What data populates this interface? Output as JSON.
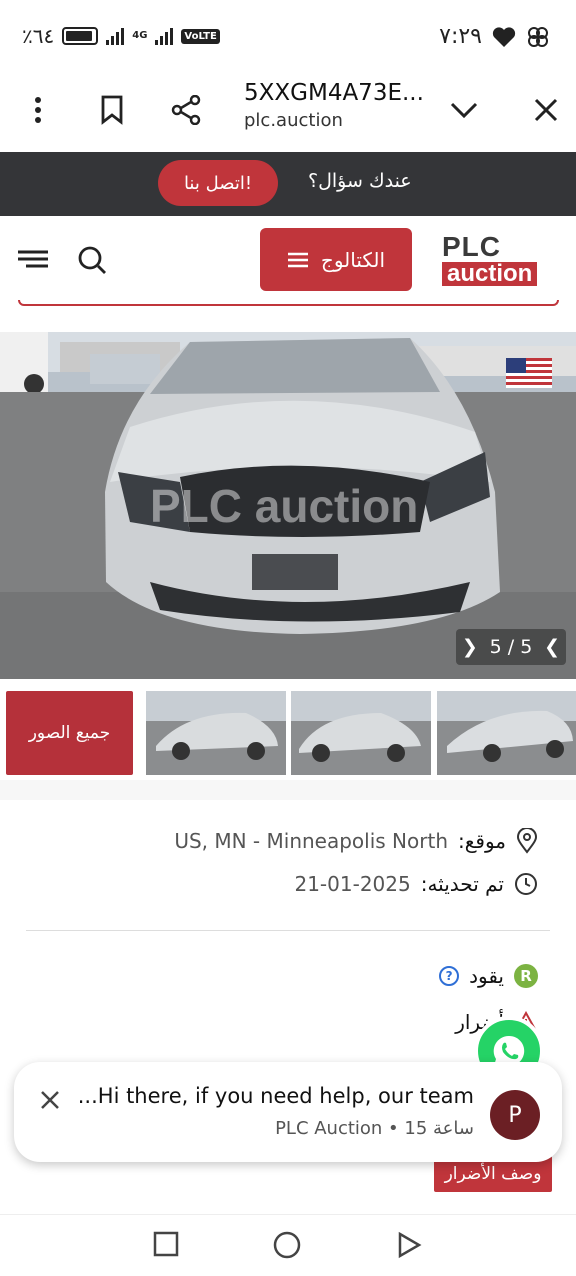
{
  "status_bar": {
    "battery_text": "٪٦٤",
    "network": "4G",
    "sim_slots": "1\n2",
    "volte": "VoLTE",
    "time": "٧:٢٩"
  },
  "browser": {
    "page_title": "5XXGM4A73E...",
    "host": "plc.auction",
    "icons": [
      "menu-dots-icon",
      "bookmark-icon",
      "share-icon",
      "chevron-down-icon",
      "close-icon"
    ]
  },
  "banner": {
    "question": "عندك سؤال؟",
    "contact_label": "اتصل بنا!"
  },
  "header": {
    "catalog_label": "الكتالوج",
    "logo_top": "PLC",
    "logo_bottom": "auction"
  },
  "gallery": {
    "pager": "5 / 5",
    "watermark": "PLC auction",
    "all_photos_label": "جميع الصور",
    "thumb_count": 3
  },
  "info": {
    "location_label": "موقع:",
    "location_value": "US, MN - Minneapolis North",
    "updated_label": "تم تحديثه:",
    "updated_value": "21-01-2025",
    "fuel_badge": "R",
    "fuel_label": "يقود",
    "help_badge": "?",
    "damage_label": "أضرار",
    "damage_button": "وصف الأضرار"
  },
  "toast": {
    "avatar": "P",
    "message": "...Hi there, if you need help, our team",
    "meta": "PLC Auction • 15 ساعة"
  },
  "colors": {
    "brand_red": "#c0353b",
    "banner_dark": "#343538",
    "whatsapp_green": "#25d366"
  }
}
